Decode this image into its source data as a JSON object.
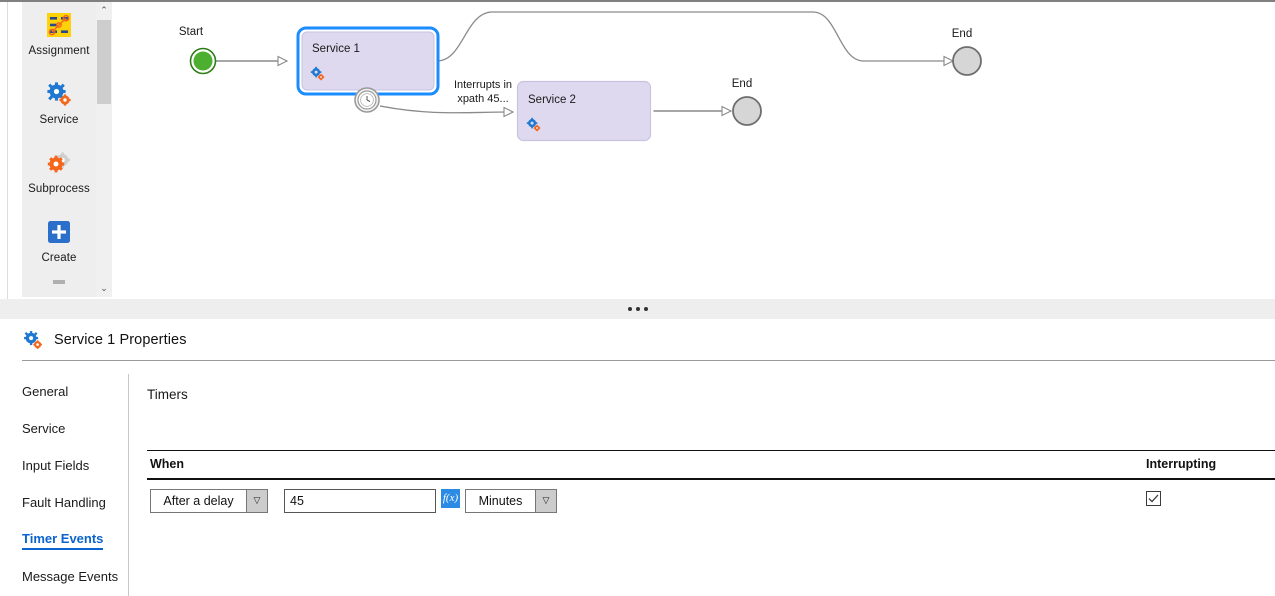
{
  "palette": {
    "items": [
      {
        "label": "Assignment",
        "icon": "assignment-icon"
      },
      {
        "label": "Service",
        "icon": "service-gears-icon"
      },
      {
        "label": "Subprocess",
        "icon": "subprocess-gears-icon"
      },
      {
        "label": "Create",
        "icon": "create-plus-icon"
      }
    ],
    "scrollbar": {
      "up": "⌃",
      "down": "⌄"
    }
  },
  "diagram": {
    "nodes": [
      {
        "id": "start",
        "type": "start-event",
        "label": "Start"
      },
      {
        "id": "service1",
        "type": "service-task",
        "label": "Service 1",
        "selected": true
      },
      {
        "id": "timer",
        "type": "boundary-timer-event",
        "label": ""
      },
      {
        "id": "service2",
        "type": "service-task",
        "label": "Service 2",
        "selected": false
      },
      {
        "id": "end1",
        "type": "end-event",
        "label": "End"
      },
      {
        "id": "end2",
        "type": "end-event",
        "label": "End"
      }
    ],
    "edges": [
      {
        "from": "start",
        "to": "service1",
        "label": ""
      },
      {
        "from": "service1",
        "to": "end2",
        "label": ""
      },
      {
        "from": "timer",
        "to": "service2",
        "label": "Interrupts in\nxpath 45..."
      },
      {
        "from": "service2",
        "to": "end1",
        "label": ""
      }
    ],
    "edge_labels": {
      "timer_line1": "Interrupts in",
      "timer_line2": "xpath 45..."
    },
    "colors": {
      "start_fill": "#4caf2f",
      "start_ring": "#2e7d16",
      "end_fill": "#d6d6d6",
      "end_ring": "#6e6e6e",
      "task_fill": "#ded9ef",
      "task_border": "#c9c2e0",
      "selection": "#1a8cff",
      "connector": "#8a8a8a",
      "gear_blue": "#1f78d1",
      "gear_orange": "#f4661b"
    }
  },
  "splitter": {
    "handle": "drag-handle"
  },
  "properties": {
    "title": "Service 1 Properties",
    "tabs": [
      {
        "label": "General",
        "active": false
      },
      {
        "label": "Service",
        "active": false
      },
      {
        "label": "Input Fields",
        "active": false
      },
      {
        "label": "Fault Handling",
        "active": false
      },
      {
        "label": "Timer Events",
        "active": true
      },
      {
        "label": "Message Events",
        "active": false
      }
    ],
    "content": {
      "section_title": "Timers",
      "table": {
        "columns": [
          "When",
          "Interrupting"
        ],
        "row": {
          "when_select": {
            "value": "After a delay",
            "options": [
              "After a delay"
            ]
          },
          "delay_value": "45",
          "delay_placeholder": "",
          "fx_label": "f(x)",
          "unit_select": {
            "value": "Minutes",
            "options": [
              "Minutes"
            ]
          },
          "interrupting_checked": true
        }
      }
    },
    "accent": "#0b63ce"
  }
}
